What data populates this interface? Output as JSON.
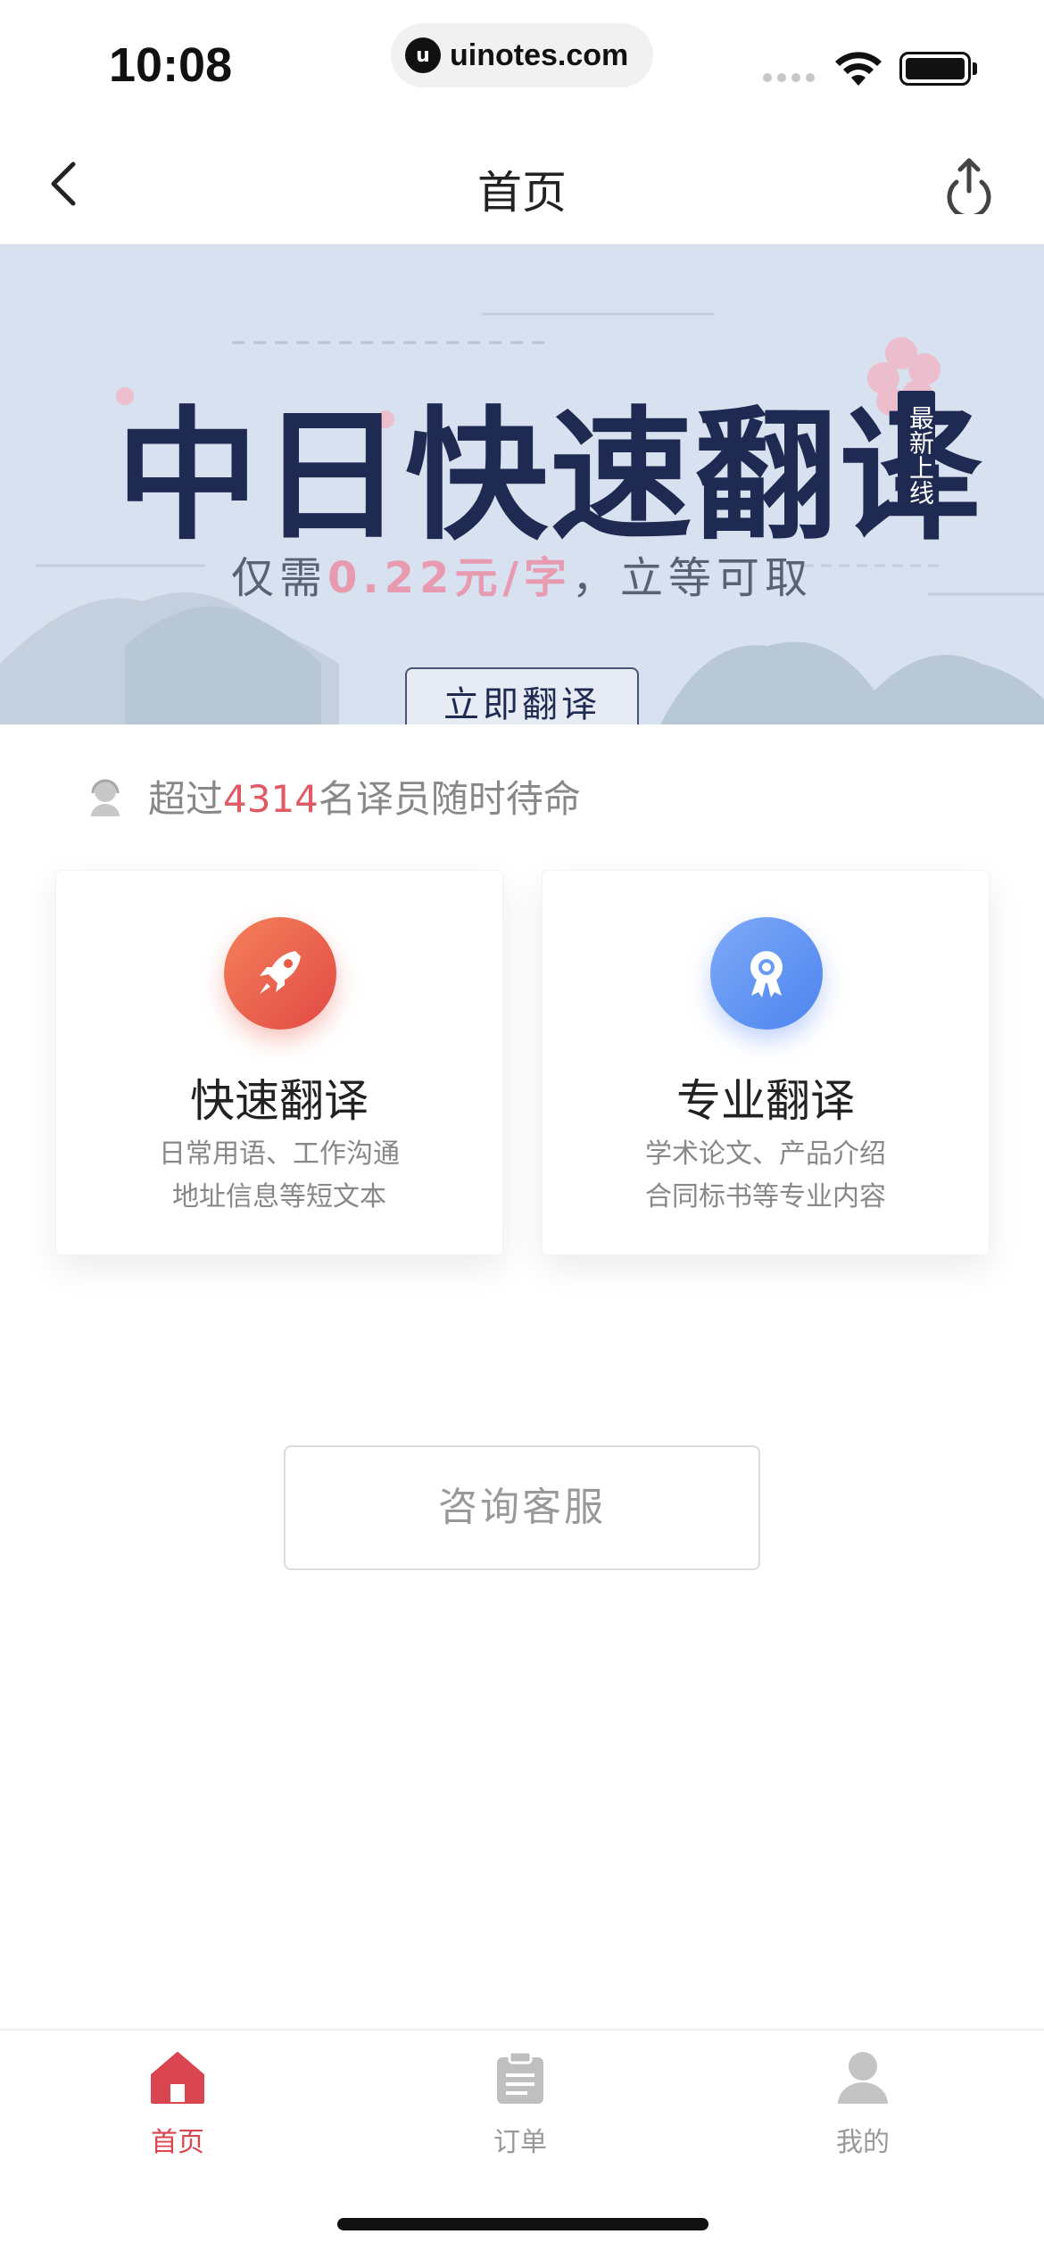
{
  "status_bar": {
    "time": "10:08",
    "url": "uinotes.com",
    "url_icon": "u"
  },
  "nav": {
    "title": "首页",
    "back_icon": "chevron-left-icon",
    "share_icon": "share-icon"
  },
  "banner": {
    "title": "中日快速翻译",
    "badge": "最新上线",
    "subtitle_prefix": "仅需",
    "subtitle_price": "0.22元/字",
    "subtitle_suffix": "，立等可取",
    "cta": "立即翻译"
  },
  "translators": {
    "prefix": "超过",
    "count": "4314",
    "suffix": "名译员随时待命"
  },
  "services": [
    {
      "title": "快速翻译",
      "desc_line1": "日常用语、工作沟通",
      "desc_line2": "地址信息等短文本",
      "icon": "rocket-icon"
    },
    {
      "title": "专业翻译",
      "desc_line1": "学术论文、产品介绍",
      "desc_line2": "合同标书等专业内容",
      "icon": "award-icon"
    }
  ],
  "consult_button": "咨询客服",
  "tab_bar": [
    {
      "label": "首页",
      "icon": "home-icon",
      "active": true
    },
    {
      "label": "订单",
      "icon": "clipboard-icon",
      "active": false
    },
    {
      "label": "我的",
      "icon": "user-icon",
      "active": false
    }
  ],
  "colors": {
    "accent": "#d9464f",
    "banner_bg": "#d8e1ef",
    "banner_title": "#1f2a52",
    "price_pink": "#e79ab0",
    "fast_icon": "#e85a46",
    "pro_icon": "#5b8ff0"
  }
}
